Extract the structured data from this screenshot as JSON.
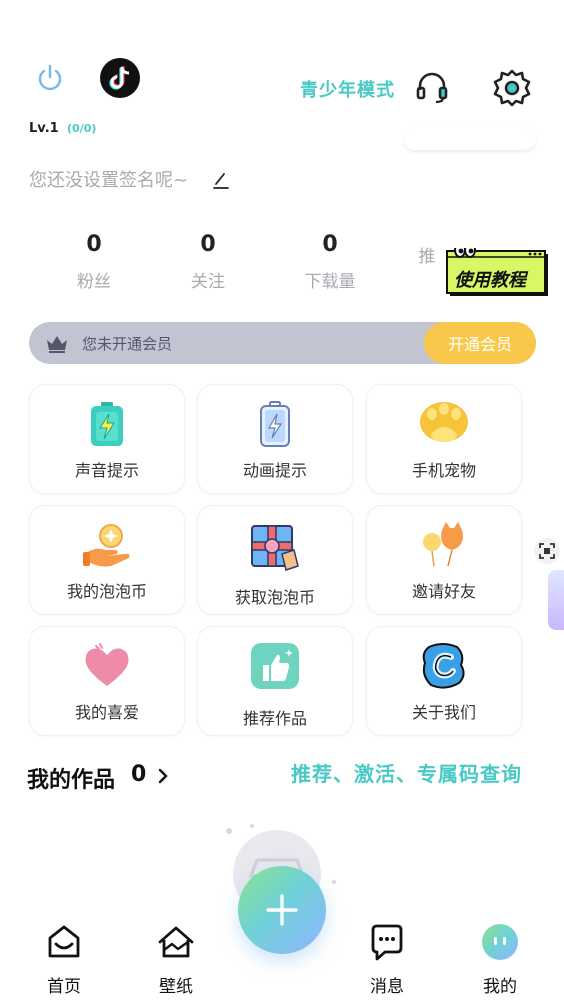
{
  "header": {
    "teen_mode_label": "青少年模式",
    "icons": [
      "power-icon",
      "tiktok-icon",
      "headset-icon",
      "gear-icon"
    ],
    "accent_color": "#48c9c6"
  },
  "profile": {
    "level": "Lv.1",
    "level_progress": "(0/0)",
    "signature": "您还没设置签名呢~"
  },
  "stats": [
    {
      "value": "0",
      "label": "粉丝"
    },
    {
      "value": "0",
      "label": "关注"
    },
    {
      "value": "0",
      "label": "下载量"
    },
    {
      "value": "",
      "label": "推"
    }
  ],
  "tutorial": {
    "label": "使用教程"
  },
  "vip": {
    "status": "您未开通会员",
    "button": "开通会员",
    "button_color": "#f8c84b"
  },
  "grid": [
    {
      "label": "声音提示",
      "icon": "battery-charge-icon"
    },
    {
      "label": "动画提示",
      "icon": "battery-outline-icon"
    },
    {
      "label": "手机宠物",
      "icon": "paw-icon"
    },
    {
      "label": "我的泡泡币",
      "icon": "coin-hand-icon"
    },
    {
      "label": "获取泡泡币",
      "icon": "gift-icon"
    },
    {
      "label": "邀请好友",
      "icon": "balloon-icon"
    },
    {
      "label": "我的喜爱",
      "icon": "heart-icon"
    },
    {
      "label": "推荐作品",
      "icon": "thumbs-up-icon"
    },
    {
      "label": "关于我们",
      "icon": "app-logo-icon"
    }
  ],
  "works": {
    "title": "我的作品",
    "count": "0",
    "code_query": "推荐、激活、专属码查询"
  },
  "bottom_nav": [
    {
      "label": "首页",
      "icon": "home-icon"
    },
    {
      "label": "壁纸",
      "icon": "wallpaper-icon"
    },
    {
      "label": "",
      "icon": "plus-icon"
    },
    {
      "label": "消息",
      "icon": "message-icon"
    },
    {
      "label": "我的",
      "icon": "profile-icon"
    }
  ]
}
